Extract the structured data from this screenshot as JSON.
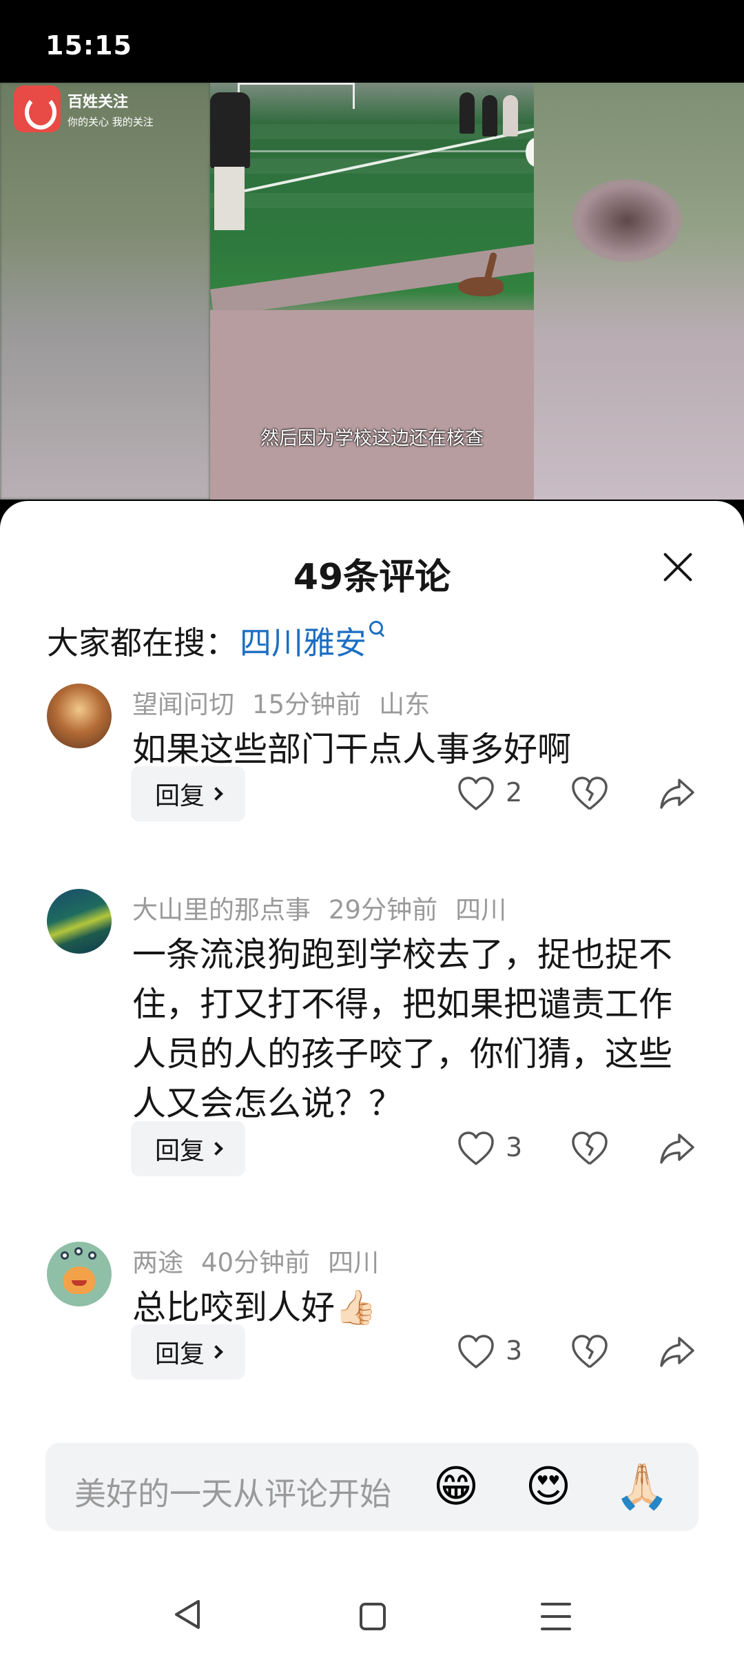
{
  "status_bar": {
    "time": "15:15"
  },
  "video": {
    "logo_title": "百姓关注",
    "logo_sub": "你的关心 我的关注",
    "subtitle": "然后因为学校这边还在核查"
  },
  "sheet": {
    "title": "49条评论",
    "hot_search_label": "大家都在搜：",
    "hot_search_term": "四川雅安",
    "comments": [
      {
        "user": "望闻问切",
        "time": "15分钟前",
        "location": "山东",
        "text": "如果这些部门干点人事多好啊",
        "reply_label": "回复",
        "likes": "2"
      },
      {
        "user": "大山里的那点事",
        "time": "29分钟前",
        "location": "四川",
        "text": "一条流浪狗跑到学校去了，捉也捉不住，打又打不得，把如果把谴责工作人员的人的孩子咬了，你们猜，这些人又会怎么说？？",
        "reply_label": "回复",
        "likes": "3"
      },
      {
        "user": "两途",
        "time": "40分钟前",
        "location": "四川",
        "text": "总比咬到人好👍🏻",
        "reply_label": "回复",
        "likes": "3"
      }
    ]
  },
  "input_bar": {
    "placeholder": "美好的一天从评论开始",
    "emojis": [
      "😁",
      "😍",
      "🙏🏻"
    ]
  },
  "icons": {
    "like": "heart-outline-icon",
    "dislike": "broken-heart-icon",
    "share": "share-arrow-icon",
    "close": "close-icon",
    "search": "search-icon",
    "back": "back-triangle-icon",
    "home": "home-square-icon",
    "menu": "menu-lines-icon"
  },
  "colors": {
    "link_blue": "#1c6ec2",
    "text_primary": "#161616",
    "text_meta": "#9a9a9a",
    "logo_red": "#e84a45"
  }
}
